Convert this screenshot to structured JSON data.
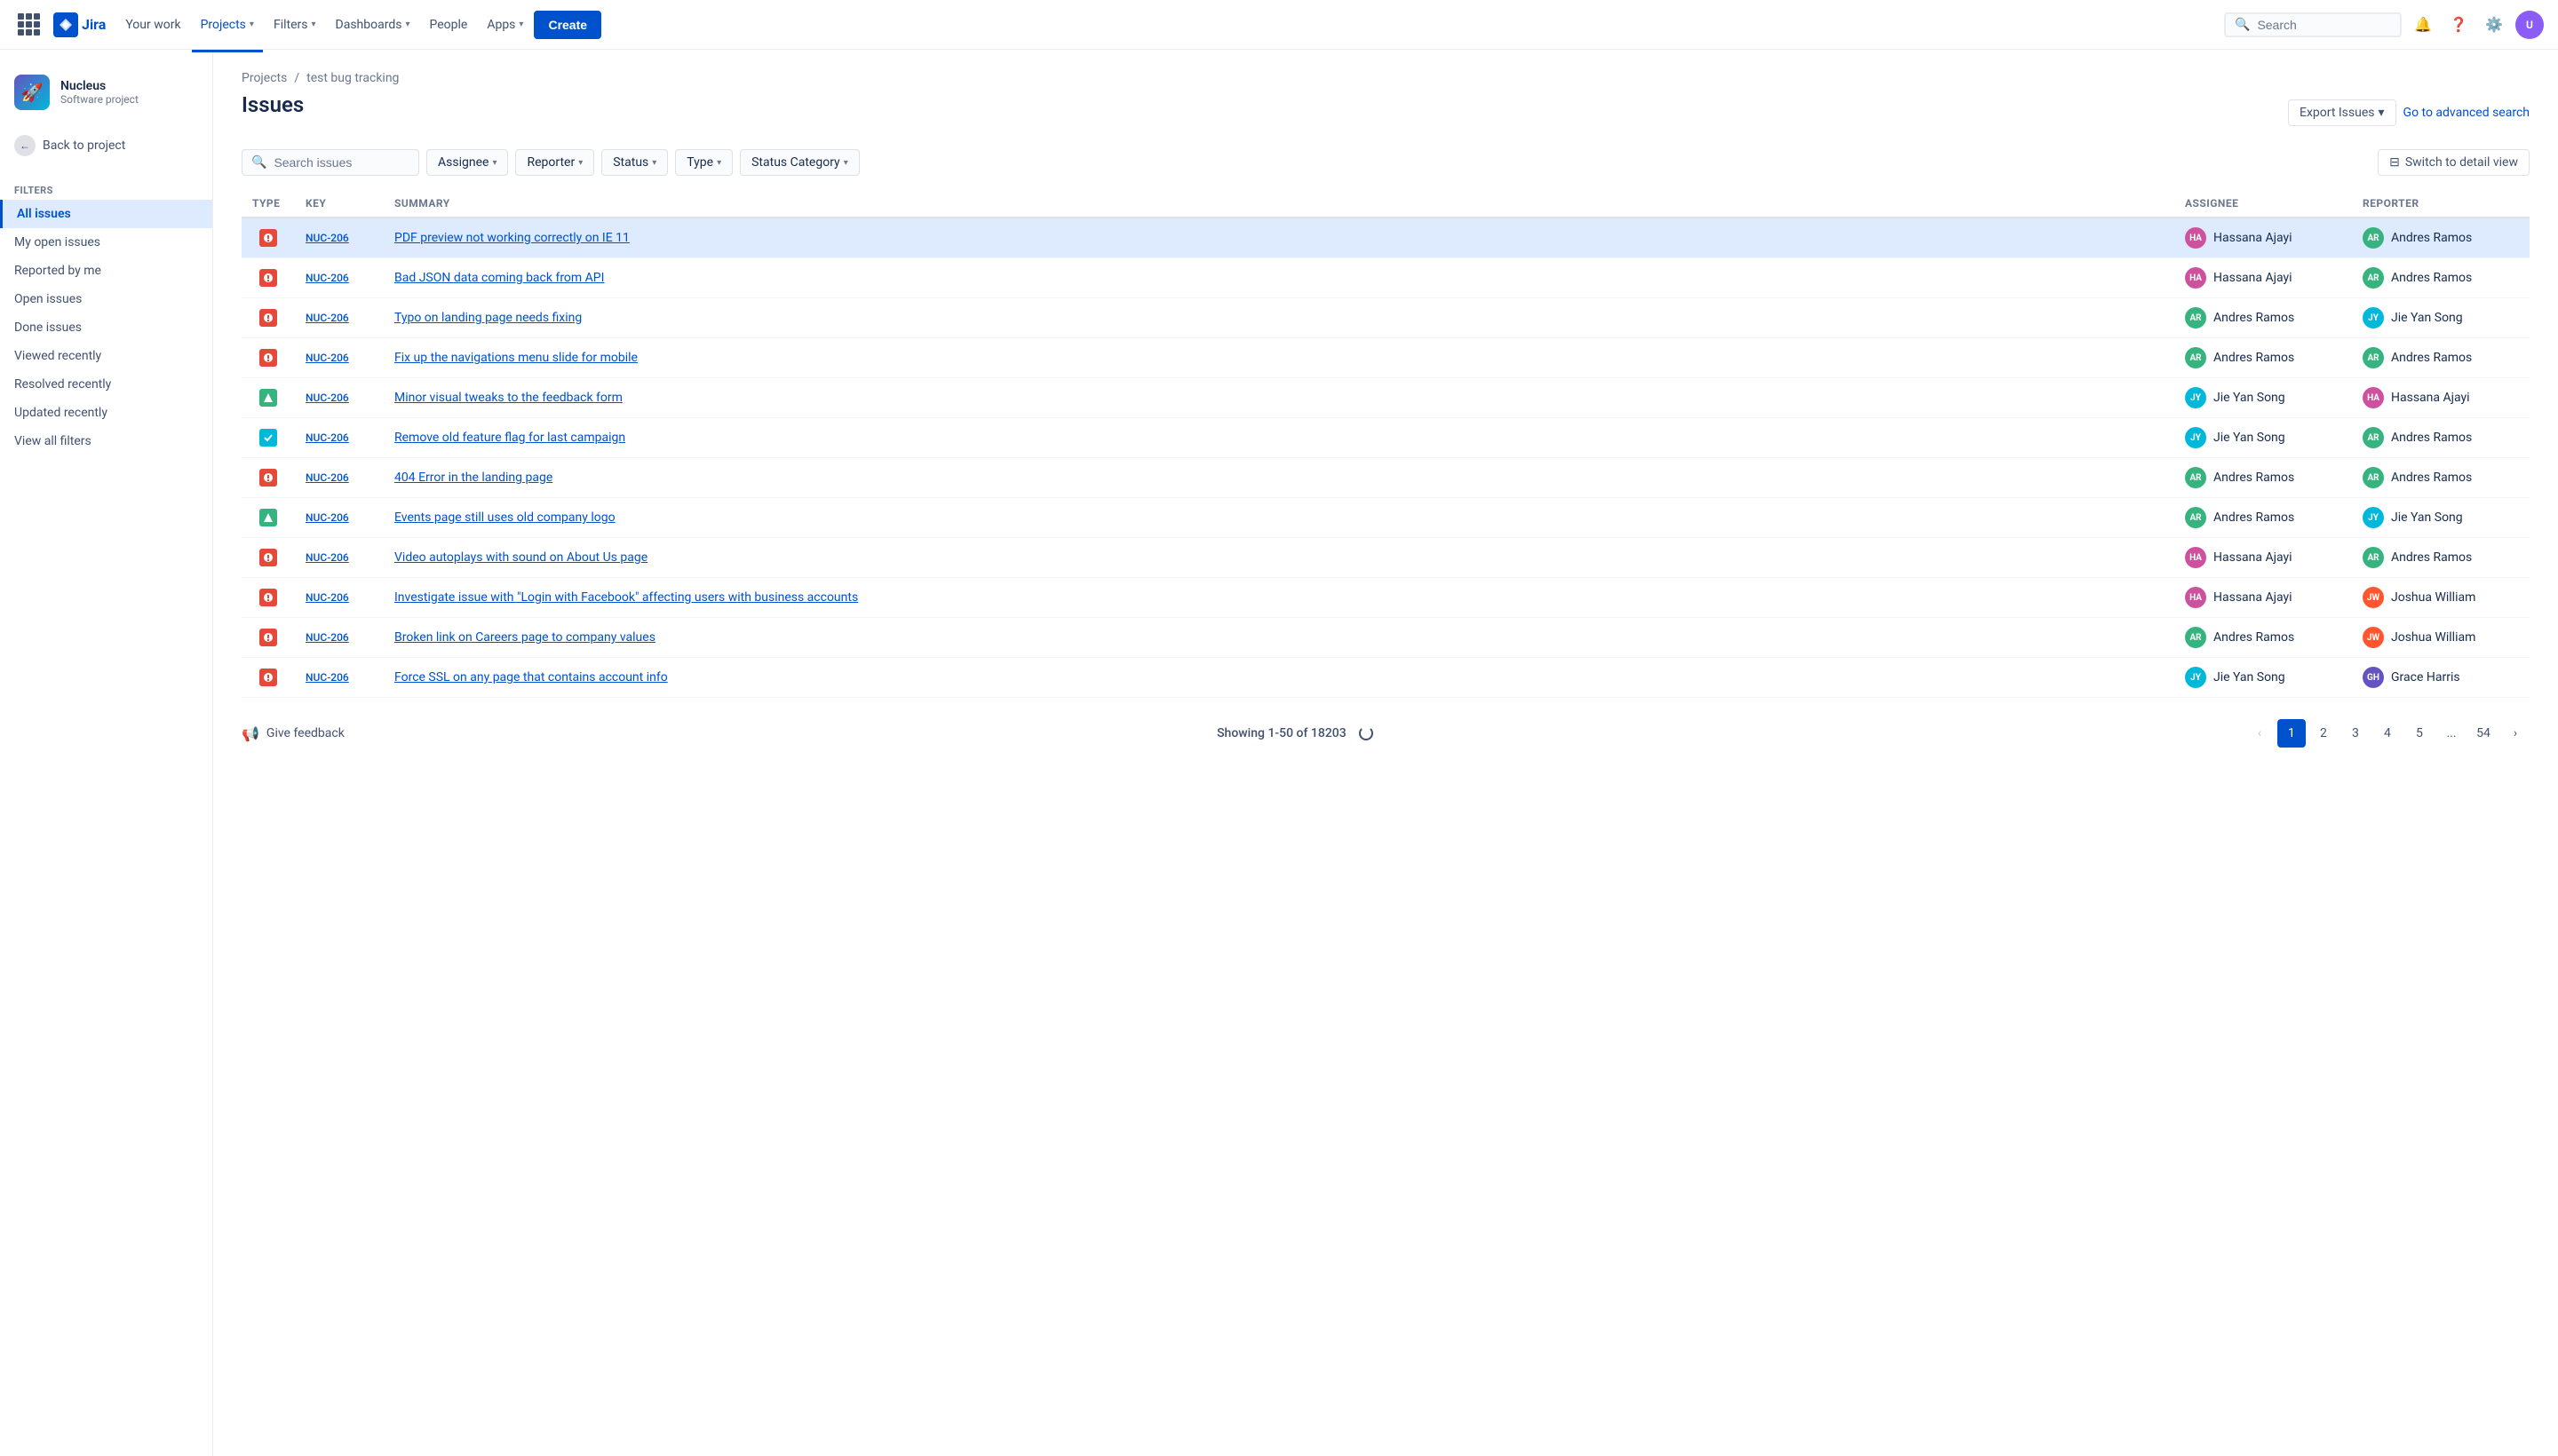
{
  "topnav": {
    "logo_text": "Jira",
    "nav_items": [
      {
        "label": "Your work",
        "active": false
      },
      {
        "label": "Projects",
        "active": true,
        "has_chevron": true
      },
      {
        "label": "Filters",
        "active": false,
        "has_chevron": true
      },
      {
        "label": "Dashboards",
        "active": false,
        "has_chevron": true
      },
      {
        "label": "People",
        "active": false,
        "has_chevron": false
      },
      {
        "label": "Apps",
        "active": false,
        "has_chevron": true
      }
    ],
    "create_label": "Create",
    "search_placeholder": "Search"
  },
  "sidebar": {
    "project_name": "Nucleus",
    "project_type": "Software project",
    "back_label": "Back to project",
    "section_header": "Filters",
    "items": [
      {
        "label": "All issues",
        "active": true
      },
      {
        "label": "My open issues",
        "active": false
      },
      {
        "label": "Reported by me",
        "active": false
      },
      {
        "label": "Open issues",
        "active": false
      },
      {
        "label": "Done issues",
        "active": false
      },
      {
        "label": "Viewed recently",
        "active": false
      },
      {
        "label": "Resolved recently",
        "active": false
      },
      {
        "label": "Updated recently",
        "active": false
      },
      {
        "label": "View all filters",
        "active": false
      }
    ]
  },
  "breadcrumb": {
    "projects_label": "Projects",
    "project_name": "test bug tracking"
  },
  "page": {
    "title": "Issues",
    "export_label": "Export Issues",
    "advanced_search_label": "Go to advanced search",
    "detail_view_label": "Switch to detail view"
  },
  "filters": {
    "search_placeholder": "Search issues",
    "assignee_label": "Assignee",
    "reporter_label": "Reporter",
    "status_label": "Status",
    "type_label": "Type",
    "status_category_label": "Status Category"
  },
  "table": {
    "headers": [
      "Type",
      "Key",
      "Summary",
      "Assignee",
      "Reporter"
    ],
    "rows": [
      {
        "type": "bug",
        "key": "NUC-206",
        "summary": "PDF preview not working correctly on IE 11",
        "assignee": "Hassana Ajayi",
        "assignee_av": "ha",
        "reporter": "Andres Ramos",
        "reporter_av": "ar",
        "selected": true
      },
      {
        "type": "bug",
        "key": "NUC-206",
        "summary": "Bad JSON data coming back from API",
        "assignee": "Hassana Ajayi",
        "assignee_av": "ha",
        "reporter": "Andres Ramos",
        "reporter_av": "ar",
        "selected": false
      },
      {
        "type": "bug",
        "key": "NUC-206",
        "summary": "Typo on landing page needs fixing",
        "assignee": "Andres Ramos",
        "assignee_av": "ar",
        "reporter": "Jie Yan Song",
        "reporter_av": "jy",
        "selected": false
      },
      {
        "type": "bug",
        "key": "NUC-206",
        "summary": "Fix up the navigations menu slide for mobile",
        "assignee": "Andres Ramos",
        "assignee_av": "ar",
        "reporter": "Andres Ramos",
        "reporter_av": "ar",
        "selected": false
      },
      {
        "type": "improvement",
        "key": "NUC-206",
        "summary": "Minor visual tweaks to the feedback form",
        "assignee": "Jie Yan Song",
        "assignee_av": "jy",
        "reporter": "Hassana Ajayi",
        "reporter_av": "ha",
        "selected": false
      },
      {
        "type": "done",
        "key": "NUC-206",
        "summary": "Remove old feature flag for last campaign",
        "assignee": "Jie Yan Song",
        "assignee_av": "jy",
        "reporter": "Andres Ramos",
        "reporter_av": "ar",
        "selected": false
      },
      {
        "type": "bug",
        "key": "NUC-206",
        "summary": "404 Error in the landing page",
        "assignee": "Andres Ramos",
        "assignee_av": "ar",
        "reporter": "Andres Ramos",
        "reporter_av": "ar",
        "selected": false
      },
      {
        "type": "improvement",
        "key": "NUC-206",
        "summary": "Events page still uses old company logo",
        "assignee": "Andres Ramos",
        "assignee_av": "ar",
        "reporter": "Jie Yan Song",
        "reporter_av": "jy",
        "selected": false
      },
      {
        "type": "bug",
        "key": "NUC-206",
        "summary": "Video autoplays with sound on About Us page",
        "assignee": "Hassana Ajayi",
        "assignee_av": "ha",
        "reporter": "Andres Ramos",
        "reporter_av": "ar",
        "selected": false
      },
      {
        "type": "bug",
        "key": "NUC-206",
        "summary": "Investigate issue with \"Login with Facebook\" affecting users with business accounts",
        "assignee": "Hassana Ajayi",
        "assignee_av": "ha",
        "reporter": "Joshua William",
        "reporter_av": "jw",
        "selected": false
      },
      {
        "type": "bug",
        "key": "NUC-206",
        "summary": "Broken link on Careers page to company values",
        "assignee": "Andres Ramos",
        "assignee_av": "ar",
        "reporter": "Joshua William",
        "reporter_av": "jw",
        "selected": false
      },
      {
        "type": "bug",
        "key": "NUC-206",
        "summary": "Force SSL on any page that contains account info",
        "assignee": "Jie Yan Song",
        "assignee_av": "jy",
        "reporter": "Grace Harris",
        "reporter_av": "gh",
        "selected": false
      }
    ]
  },
  "pagination": {
    "showing_label": "Showing 1-50 of 18203",
    "pages": [
      "1",
      "2",
      "3",
      "4",
      "5",
      "...",
      "54"
    ],
    "current_page": "1"
  },
  "feedback": {
    "label": "Give feedback"
  }
}
